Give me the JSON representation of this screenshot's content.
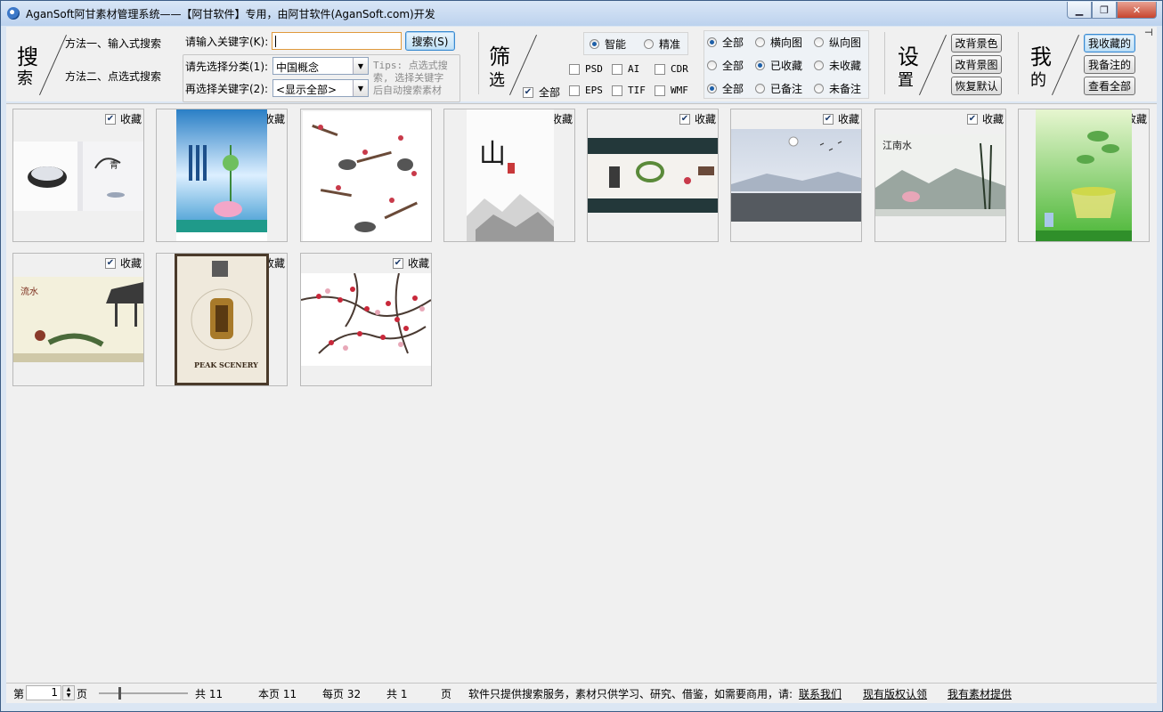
{
  "window": {
    "title": "AganSoft阿甘素材管理系统——【阿甘软件】专用，由阿甘软件(AganSoft.com)开发",
    "min_icon": "minimize-icon",
    "max_icon": "maximize-icon",
    "close_icon": "close-icon"
  },
  "search": {
    "title_char1": "搜",
    "title_char2": "索",
    "method1": "方法一、输入式搜索",
    "method2": "方法二、点选式搜索",
    "keyword_label": "请输入关键字(K):",
    "keyword_value": "",
    "search_button": "搜索(S)",
    "category_label": "请先选择分类(1):",
    "category_value": "中国概念",
    "subkey_label": "再选择关键字(2):",
    "subkey_value": "<显示全部>",
    "tips_line1": "Tips: 点选式搜",
    "tips_line2": "索, 选择关键字",
    "tips_line3": "后自动搜索素材"
  },
  "filter": {
    "title_char1": "筛",
    "title_char2": "选",
    "all_check": "全部",
    "mode_options": [
      "智能",
      "精准"
    ],
    "formats_row1": [
      "PSD",
      "AI",
      "CDR"
    ],
    "formats_row2": [
      "EPS",
      "TIF",
      "WMF"
    ],
    "orientation": [
      "全部",
      "横向图",
      "纵向图"
    ],
    "favorite": [
      "全部",
      "已收藏",
      "未收藏"
    ],
    "note": [
      "全部",
      "已备注",
      "未备注"
    ]
  },
  "settings": {
    "title_char1": "设",
    "title_char2": "置",
    "bg_color": "改背景色",
    "bg_image": "改背景图",
    "restore": "恢复默认"
  },
  "mine": {
    "title_char1": "我",
    "title_char2": "的",
    "my_favorites": "我收藏的",
    "my_notes": "我备注的",
    "view_all": "查看全部"
  },
  "gallery": {
    "fav_label": "收藏",
    "items": [
      {
        "name": "ink-landscape-book-cover"
      },
      {
        "name": "lotus-poster-blue"
      },
      {
        "name": "ink-plum-collection"
      },
      {
        "name": "calligraphy-mountain"
      },
      {
        "name": "ink-banner-dark"
      },
      {
        "name": "misty-lake-cranes"
      },
      {
        "name": "jiangnan-bamboo"
      },
      {
        "name": "green-tea-cup"
      },
      {
        "name": "chinese-pavilion"
      },
      {
        "name": "peak-scenery-poster"
      },
      {
        "name": "plum-blossom-branches"
      }
    ],
    "peak_text": "PEAK SCENERY"
  },
  "status": {
    "page_prefix": "第",
    "page_value": "1",
    "page_suffix": "页",
    "total": "共 11",
    "this_page": "本页 11",
    "per_page": "每页 32",
    "total_pages": "共 1",
    "pages_suffix": "页",
    "notice": "软件只提供搜索服务，素材只供学习、研究、借鉴，如需要商用，请:",
    "contact": "联系我们",
    "copyright": "现有版权认领",
    "provide": "我有素材提供"
  },
  "colors": {
    "title_bar": "#c4d8f0",
    "panel": "#f0f0f0",
    "window_border": "#3c5d86"
  }
}
